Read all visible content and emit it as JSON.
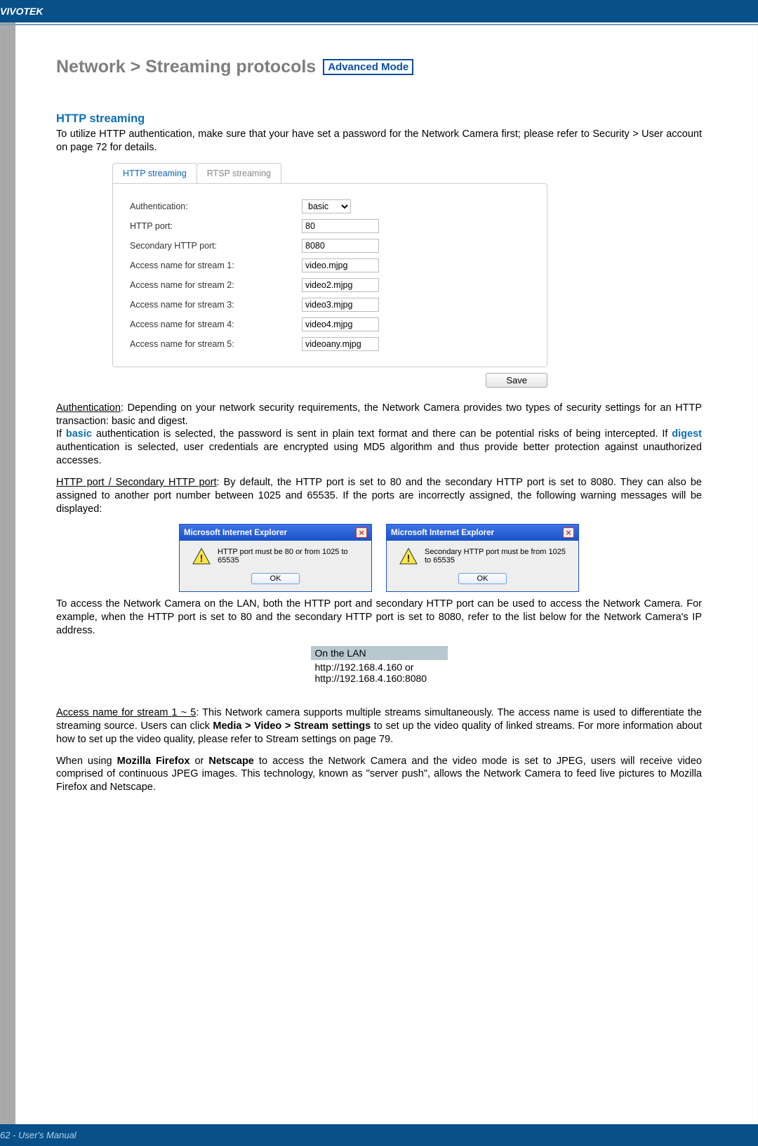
{
  "brand": "VIVOTEK",
  "pageTitle": "Network > Streaming protocols",
  "advancedLabel": "Advanced Mode",
  "sectionHeading": "HTTP streaming",
  "intro": "To utilize HTTP authentication, make sure that your have set a password for the Network Camera first; please refer to Security > User account on page 72 for details.",
  "tabs": {
    "http": "HTTP streaming",
    "rtsp": "RTSP streaming"
  },
  "form": {
    "authLabel": "Authentication:",
    "authValue": "basic",
    "httpPortLabel": "HTTP port:",
    "httpPortValue": "80",
    "secPortLabel": "Secondary HTTP port:",
    "secPortValue": "8080",
    "s1Label": "Access name for stream 1:",
    "s1Value": "video.mjpg",
    "s2Label": "Access name for stream 2:",
    "s2Value": "video2.mjpg",
    "s3Label": "Access name for stream 3:",
    "s3Value": "video3.mjpg",
    "s4Label": "Access name for stream 4:",
    "s4Value": "video4.mjpg",
    "s5Label": "Access name for stream 5:",
    "s5Value": "videoany.mjpg",
    "saveLabel": "Save"
  },
  "authPara": {
    "lead": "Authentication",
    "text1": ": Depending on your network security requirements, the Network Camera provides two types of security settings for an HTTP transaction: basic and digest.",
    "text2a": "If ",
    "basic": "basic",
    "text2b": " authentication is selected, the password is sent in plain text format and there can be potential risks of being intercepted. If ",
    "digest": "digest",
    "text2c": " authentication is selected, user credentials are encrypted using MD5 algorithm and thus provide better protection against unauthorized accesses."
  },
  "portPara": {
    "lead": "HTTP port / Secondary HTTP port",
    "text": ": By default, the HTTP port is set to 80 and the secondary HTTP port is set to 8080. They can also be assigned to another port number between 1025 and 65535. If the ports are incorrectly assigned, the following warning messages will be displayed:"
  },
  "dialog1": {
    "title": "Microsoft Internet Explorer",
    "msg": "HTTP port must be 80 or from 1025 to 65535",
    "ok": "OK"
  },
  "dialog2": {
    "title": "Microsoft Internet Explorer",
    "msg": "Secondary HTTP port must be from 1025 to 65535",
    "ok": "OK"
  },
  "lanPara": "To access the Network Camera on the LAN, both the HTTP port and secondary HTTP port can be used to access the Network Camera. For example, when the HTTP port is set to 80 and the secondary HTTP port is set to 8080, refer to the list below for the Network Camera's IP address.",
  "lanBox": {
    "head": "On the LAN",
    "line1": "http://192.168.4.160  or",
    "line2": "http://192.168.4.160:8080"
  },
  "accessPara": {
    "lead": "Access name for stream 1 ~ 5",
    "text1": ": This Network camera supports multiple streams simultaneously. The access name is used to differentiate the streaming source. Users can click ",
    "path": "Media > Video > Stream settings",
    "text2": " to set up the video quality of linked streams. For more information about how to set up the video quality, please refer to Stream settings on page 79."
  },
  "firefoxPara": {
    "text1": "When using ",
    "ff": "Mozilla Firefox",
    "text2": " or ",
    "ns": "Netscape",
    "text3": " to access the Network Camera and the video mode is set to JPEG, users will receive video comprised of continuous JPEG images. This technology, known as \"server push\", allows the Network Camera to feed live pictures to Mozilla Firefox and Netscape."
  },
  "footer": "62 - User's Manual"
}
